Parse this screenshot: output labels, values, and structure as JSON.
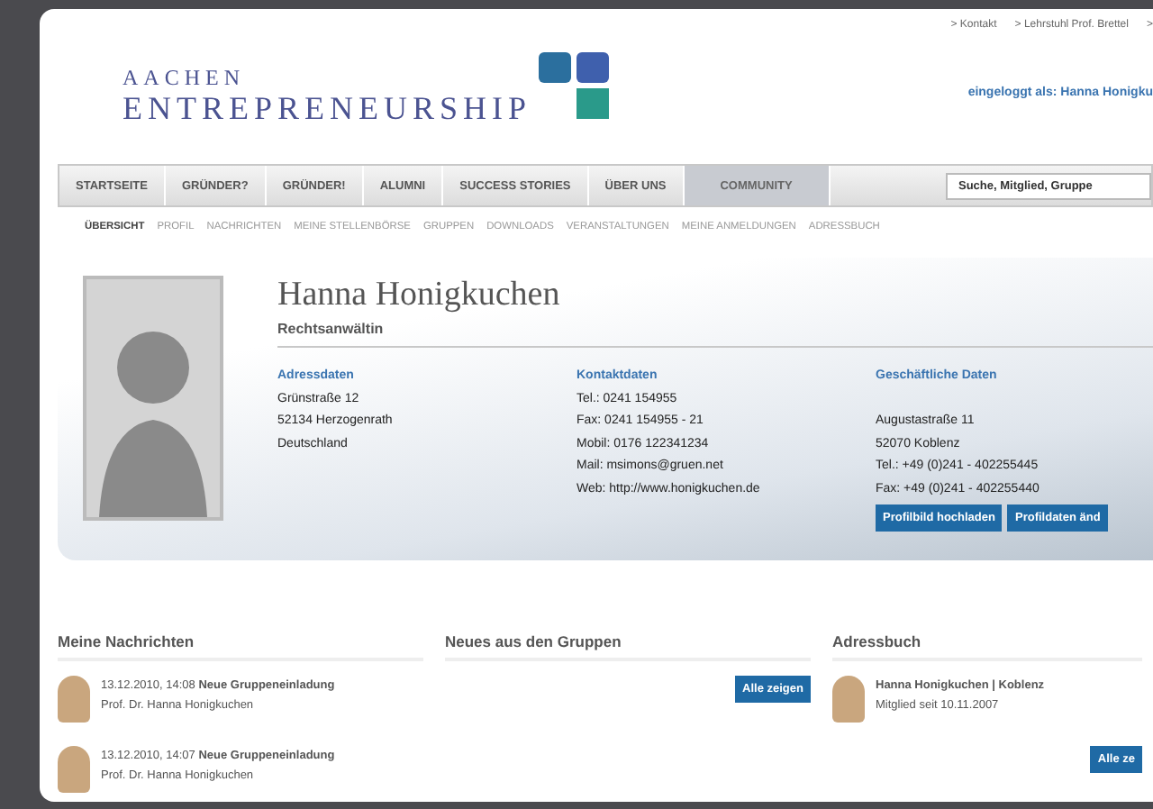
{
  "top_links": [
    "> Kontakt",
    "> Lehrstuhl Prof. Brettel",
    ">"
  ],
  "logo": {
    "line1": "AACHEN",
    "line2": "ENTREPRENEURSHIP"
  },
  "login_status": "eingeloggt als: Hanna Honigku",
  "nav": [
    {
      "label": "STARTSEITE",
      "selected": false
    },
    {
      "label": "GRÜNDER?",
      "selected": false
    },
    {
      "label": "GRÜNDER!",
      "selected": false
    },
    {
      "label": "ALUMNI",
      "selected": false
    },
    {
      "label": "SUCCESS STORIES",
      "selected": false
    },
    {
      "label": "ÜBER UNS",
      "selected": false
    },
    {
      "label": "COMMUNITY",
      "selected": true
    }
  ],
  "search": {
    "value": "Suche, Mitglied, Gruppe"
  },
  "subnav": [
    {
      "label": "ÜBERSICHT",
      "selected": true
    },
    {
      "label": "PROFIL",
      "selected": false
    },
    {
      "label": "NACHRICHTEN",
      "selected": false
    },
    {
      "label": "MEINE STELLENBÖRSE",
      "selected": false
    },
    {
      "label": "GRUPPEN",
      "selected": false
    },
    {
      "label": "DOWNLOADS",
      "selected": false
    },
    {
      "label": "VERANSTALTUNGEN",
      "selected": false
    },
    {
      "label": "MEINE ANMELDUNGEN",
      "selected": false
    },
    {
      "label": "ADRESSBUCH",
      "selected": false
    }
  ],
  "profile": {
    "name": "Hanna Honigkuchen",
    "title": "Rechtsanwältin",
    "columns": [
      {
        "heading": "Adressdaten",
        "lines": [
          "Grünstraße 12",
          "52134 Herzogenrath",
          "Deutschland"
        ]
      },
      {
        "heading": "Kontaktdaten",
        "lines": [
          "Tel.: 0241 154955",
          "Fax: 0241 154955 - 21",
          "Mobil: 0176 122341234",
          "Mail: msimons@gruen.net",
          "Web: http://www.honigkuchen.de"
        ]
      },
      {
        "heading": "Geschäftliche Daten",
        "lines": [
          "Augustastraße 11",
          "52070 Koblenz",
          "Tel.: +49 (0)241 - 402255445",
          "Fax: +49 (0)241 - 402255440"
        ]
      }
    ],
    "buttons": [
      "Profilbild hochladen",
      "Profildaten änd"
    ]
  },
  "messages": {
    "heading": "Meine Nachrichten",
    "items": [
      {
        "time": "13.12.2010, 14:08",
        "subject": "Neue Gruppeneinladung",
        "sender": "Prof. Dr. Hanna Honigkuchen"
      },
      {
        "time": "13.12.2010, 14:07",
        "subject": "Neue Gruppeneinladung",
        "sender": "Prof. Dr. Hanna Honigkuchen"
      }
    ]
  },
  "groups": {
    "heading": "Neues aus den Gruppen",
    "button": "Alle zeigen"
  },
  "addressbook": {
    "heading": "Adressbuch",
    "items": [
      {
        "name": "Hanna Honigkuchen | Koblenz",
        "since": "Mitglied seit 10.11.2007"
      }
    ],
    "button": "Alle ze"
  }
}
